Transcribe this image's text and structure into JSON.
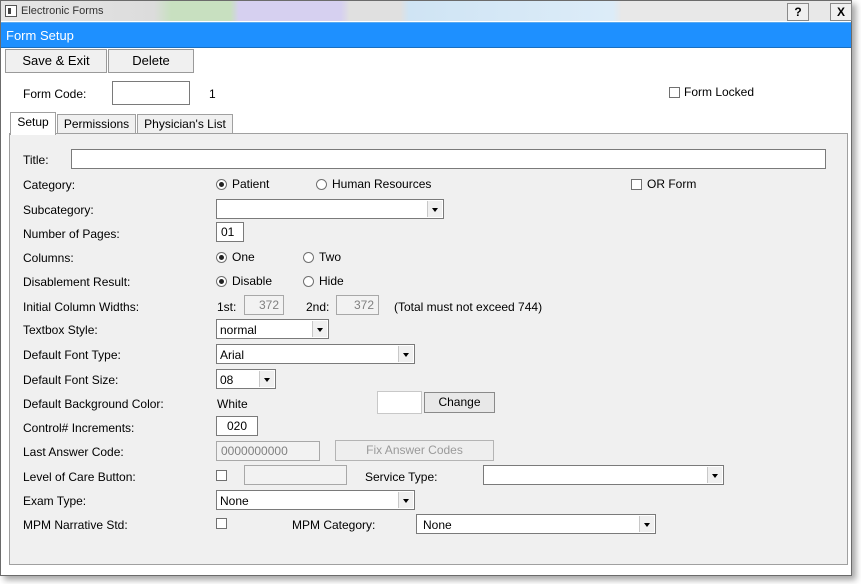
{
  "window": {
    "title": "Electronic Forms",
    "help_label": "?",
    "close_label": "X"
  },
  "form_bar": {
    "title": "Form Setup"
  },
  "toolbar": {
    "save_exit": "Save & Exit",
    "delete": "Delete"
  },
  "header": {
    "form_code_label": "Form Code:",
    "form_code_value": "",
    "form_number": "1",
    "form_locked_label": "Form Locked",
    "form_locked_checked": false
  },
  "tabs": [
    {
      "label": "Setup",
      "active": true
    },
    {
      "label": "Permissions",
      "active": false
    },
    {
      "label": "Physician's List",
      "active": false
    }
  ],
  "setup": {
    "title_label": "Title:",
    "title_value": "",
    "category_label": "Category:",
    "category_options": [
      "Patient",
      "Human Resources"
    ],
    "category_selected": "Patient",
    "or_form_label": "OR Form",
    "subcategory_label": "Subcategory:",
    "subcategory_value": "",
    "pages_label": "Number of Pages:",
    "pages_value": "01",
    "columns_label": "Columns:",
    "columns_options": [
      "One",
      "Two"
    ],
    "columns_selected": "One",
    "disable_label": "Disablement Result:",
    "disable_options": [
      "Disable",
      "Hide"
    ],
    "disable_selected": "Disable",
    "widths_label": "Initial Column Widths:",
    "width1_label": "1st:",
    "width1_value": "372",
    "width2_label": "2nd:",
    "width2_value": "372",
    "widths_note": "(Total must not exceed 744)",
    "textbox_label": "Textbox Style:",
    "textbox_value": "normal",
    "font_type_label": "Default Font Type:",
    "font_type_value": "Arial",
    "font_size_label": "Default Font Size:",
    "font_size_value": "08",
    "bg_color_label": "Default Background Color:",
    "bg_color_value": "White",
    "bg_color_swatch": "#ffffff",
    "change_button": "Change",
    "control_label": "Control# Increments:",
    "control_value": "020",
    "last_answer_label": "Last Answer Code:",
    "last_answer_value": "0000000000",
    "fix_answer_button": "Fix Answer Codes",
    "loc_label": "Level of Care Button:",
    "service_type_label": "Service Type:",
    "service_type_value": "",
    "exam_type_label": "Exam Type:",
    "exam_type_value": "None",
    "mpm_std_label": "MPM Narrative Std:",
    "mpm_category_label": "MPM Category:",
    "mpm_category_value": "None"
  }
}
